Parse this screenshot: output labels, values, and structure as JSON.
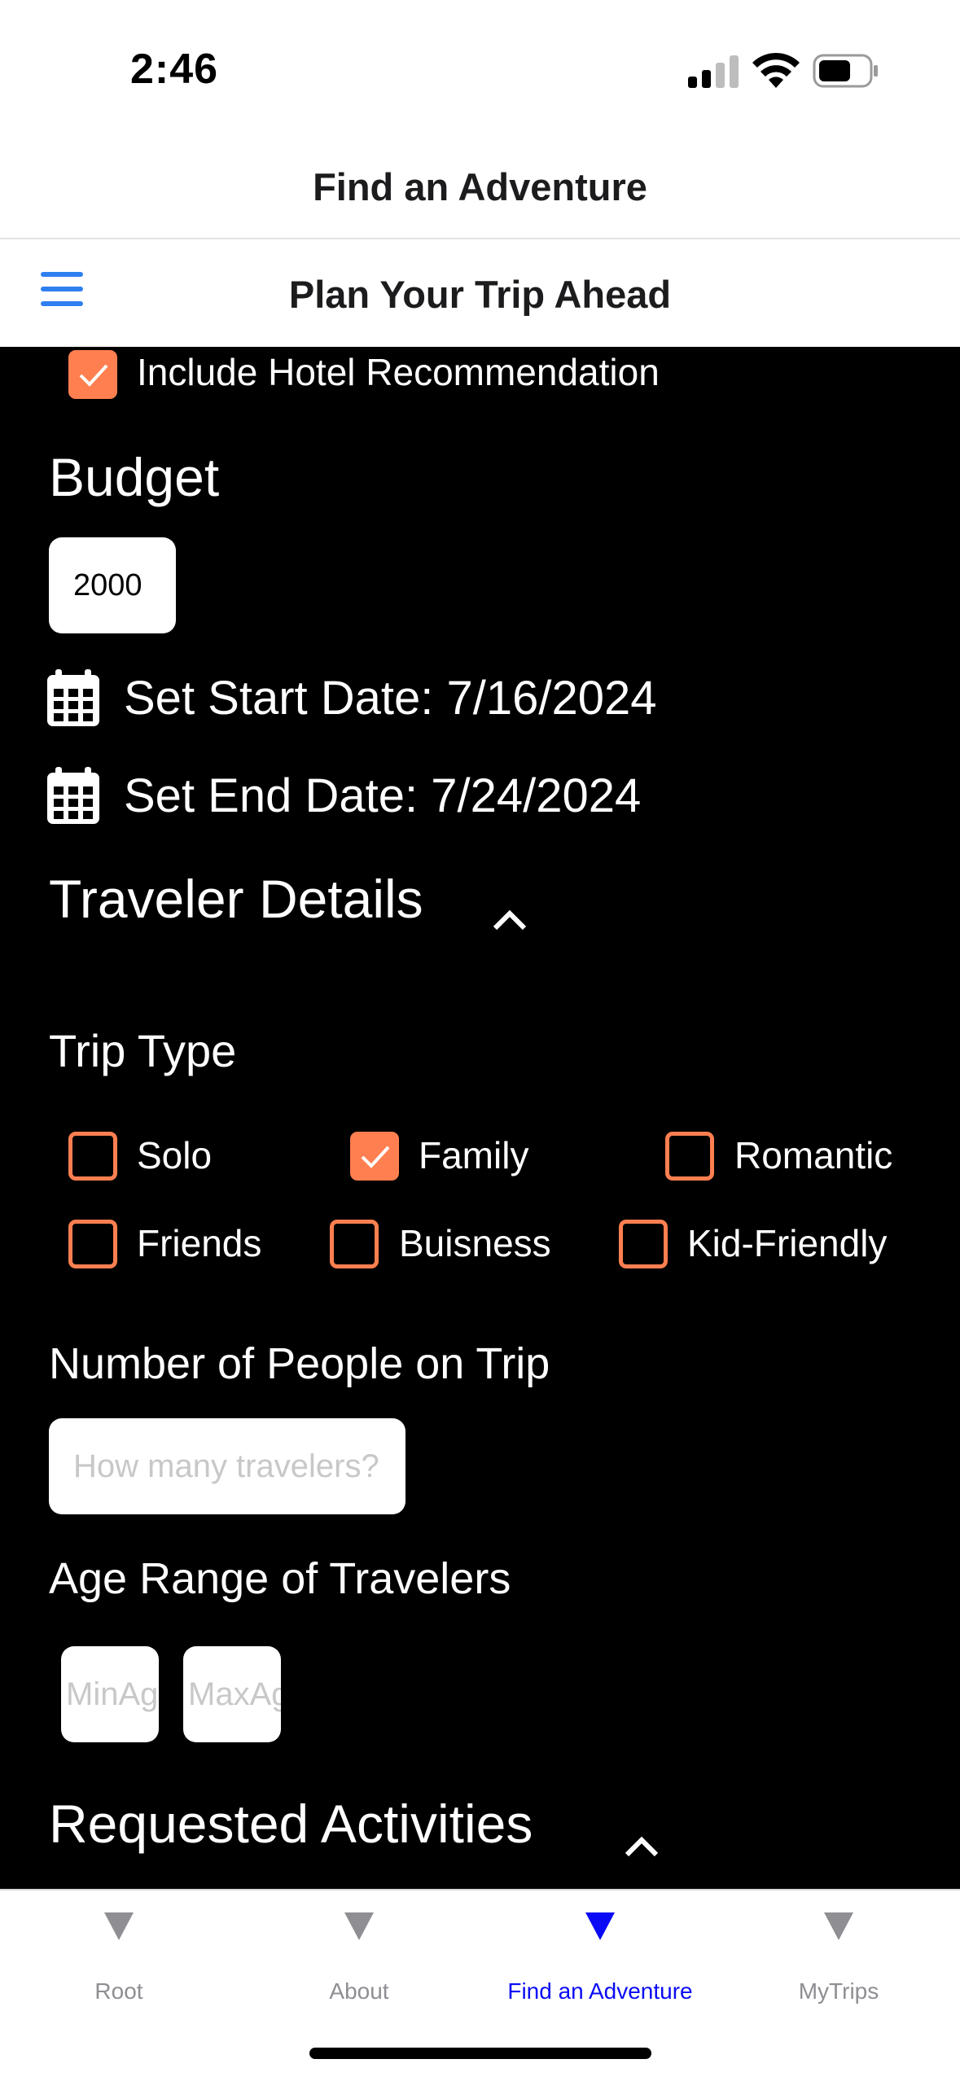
{
  "status_bar": {
    "time": "2:46"
  },
  "header": {
    "root_title": "Find an Adventure",
    "drawer_title": "Plan Your Trip Ahead"
  },
  "form": {
    "hotel": {
      "label": "Include Hotel Recommendation",
      "checked": true
    },
    "budget": {
      "label": "Budget",
      "value": "2000"
    },
    "start_date": {
      "label": "Set Start Date: 7/16/2024"
    },
    "end_date": {
      "label": "Set End Date: 7/24/2024"
    },
    "traveler_details": {
      "title": "Traveler Details"
    },
    "trip_type": {
      "title": "Trip Type",
      "options": [
        {
          "label": "Solo",
          "checked": false
        },
        {
          "label": "Family",
          "checked": true
        },
        {
          "label": "Romantic",
          "checked": false
        },
        {
          "label": "Friends",
          "checked": false
        },
        {
          "label": "Buisness",
          "checked": false
        },
        {
          "label": "Kid-Friendly",
          "checked": false
        }
      ]
    },
    "people": {
      "label": "Number of People on Trip",
      "placeholder": "How many travelers?"
    },
    "age_range": {
      "label": "Age Range of Travelers",
      "min_placeholder": "MinAge",
      "max_placeholder": "MaxAge"
    },
    "activities": {
      "title": "Requested Activities"
    }
  },
  "tab_bar": {
    "tabs": [
      {
        "label": "Root",
        "active": false
      },
      {
        "label": "About",
        "active": false
      },
      {
        "label": "Find an Adventure",
        "active": true
      },
      {
        "label": "MyTrips",
        "active": false
      }
    ]
  },
  "colors": {
    "accent": "#ff7f50",
    "menu_icon": "#2f7ff0",
    "tab_active": "#0a0af5",
    "tab_inactive": "#8e8e93"
  }
}
